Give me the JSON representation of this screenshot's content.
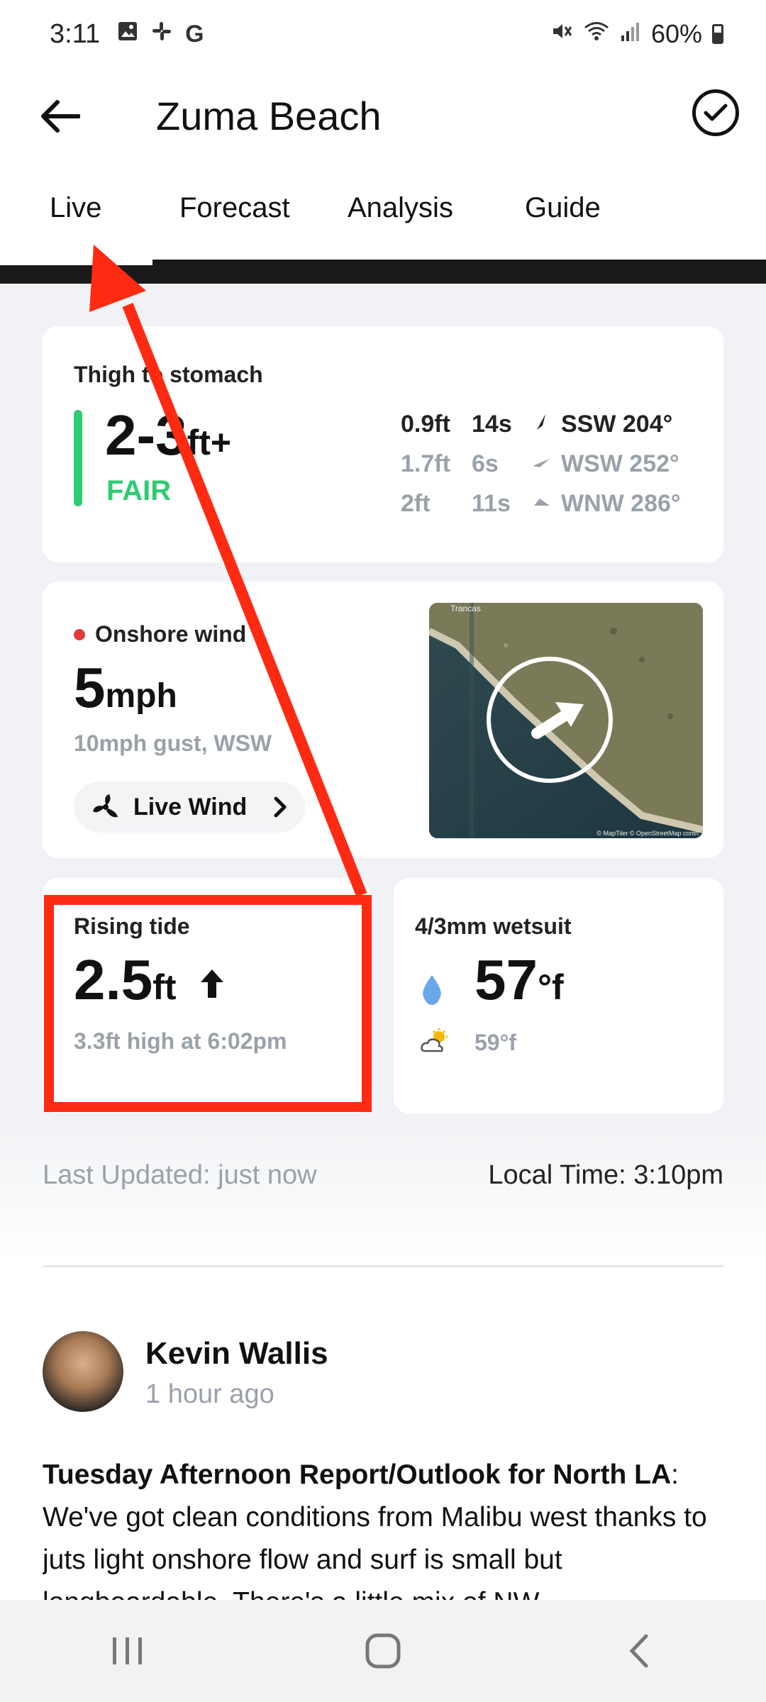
{
  "status_bar": {
    "time": "3:11",
    "left_icons": [
      "image-icon",
      "slack-icon",
      "google-icon"
    ],
    "battery": "60%"
  },
  "header": {
    "title": "Zuma Beach"
  },
  "tabs": [
    {
      "label": "Live",
      "active": true
    },
    {
      "label": "Forecast",
      "active": false
    },
    {
      "label": "Analysis",
      "active": false
    },
    {
      "label": "Guide",
      "active": false
    }
  ],
  "swell": {
    "description": "Thigh to stomach",
    "height": "2-3",
    "unit": "ft+",
    "rating": "FAIR",
    "rating_color": "#2ecc71",
    "components": [
      {
        "height": "0.9ft",
        "period": "14s",
        "direction": "SSW 204°"
      },
      {
        "height": "1.7ft",
        "period": "6s",
        "direction": "WSW 252°"
      },
      {
        "height": "2ft",
        "period": "11s",
        "direction": "WNW 286°"
      }
    ]
  },
  "wind": {
    "label": "Onshore wind",
    "speed": "5",
    "unit": "mph",
    "gust": "10mph gust, WSW",
    "button_label": "Live Wind",
    "map_label": "Trancas",
    "map_credit": "© MapTiler © OpenStreetMap contri"
  },
  "tide": {
    "label": "Rising tide",
    "height": "2.5",
    "unit": "ft",
    "next": "3.3ft high at 6:02pm"
  },
  "water": {
    "label": "4/3mm wetsuit",
    "water_temp": "57",
    "unit": "°f",
    "air_temp": "59°f"
  },
  "meta": {
    "last_updated": "Last Updated: just now",
    "local_time": "Local Time: 3:10pm"
  },
  "report": {
    "author": "Kevin Wallis",
    "time": "1 hour ago",
    "title": "Tuesday Afternoon Report/Outlook for North LA",
    "body": ": We've got clean conditions from Malibu west thanks to juts light onshore flow and surf is small but longboardable. There's a little mix of NW"
  },
  "colors": {
    "accent_green": "#2ecc71",
    "annotation_red": "#ff2a12",
    "wind_dot": "#e03b3b"
  }
}
